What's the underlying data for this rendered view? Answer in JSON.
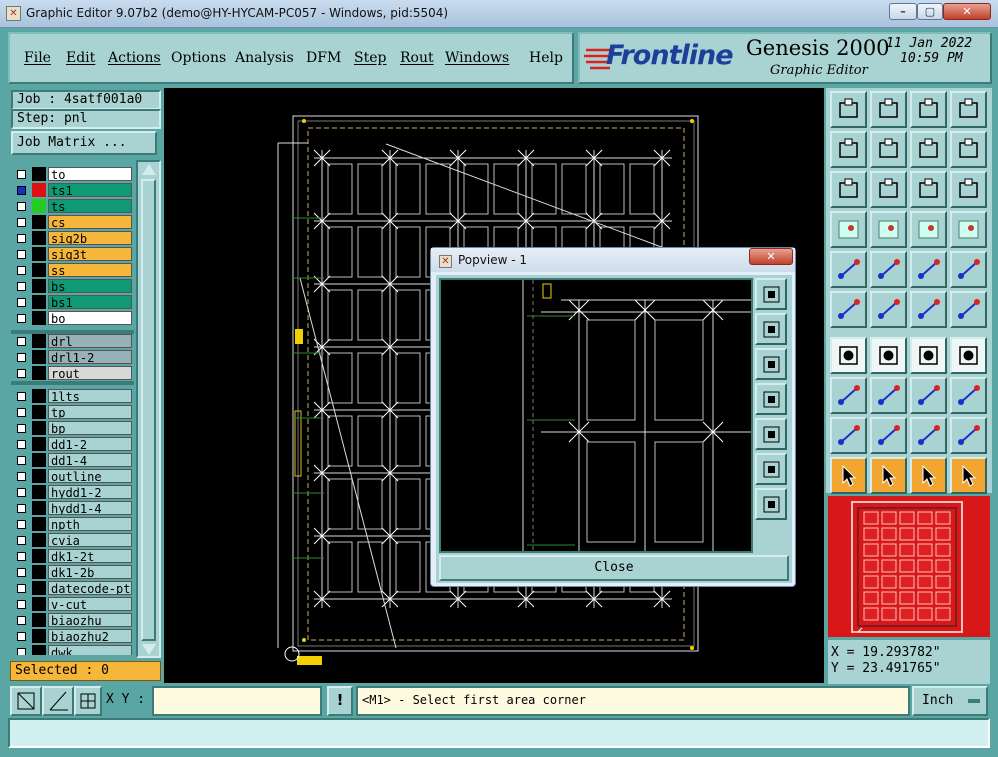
{
  "window": {
    "title": "Graphic Editor 9.07b2 (demo@HY-HYCAM-PC057 - Windows, pid:5504)",
    "min": "–",
    "max": "▢",
    "close": "✕"
  },
  "menu": {
    "file": "File",
    "edit": "Edit",
    "actions": "Actions",
    "options": "Options",
    "analysis": "Analysis",
    "dfm": "DFM",
    "step": "Step",
    "rout": "Rout",
    "windows": "Windows",
    "help": "Help"
  },
  "brand": {
    "logo": "Frontline",
    "product": "Genesis 2000",
    "subtitle": "Graphic Editor",
    "date": "11 Jan 2022",
    "time": "10:59 PM"
  },
  "job": {
    "label": "Job : 4satf001a0",
    "step": "Step: pnl",
    "matrix_button": "Job Matrix ..."
  },
  "layers": [
    {
      "name": "to",
      "color": "#ffffff",
      "sw": "#000000"
    },
    {
      "name": "ts1",
      "color": "#0e9b74",
      "sw": "#e01010",
      "sel": true
    },
    {
      "name": "ts",
      "color": "#0e9b74",
      "sw": "#22cc22"
    },
    {
      "name": "cs",
      "color": "#f5b63a",
      "sw": "#000000"
    },
    {
      "name": "sig2b",
      "color": "#f5b63a",
      "sw": "#000000"
    },
    {
      "name": "sig3t",
      "color": "#f5b63a",
      "sw": "#000000"
    },
    {
      "name": "ss",
      "color": "#f5b63a",
      "sw": "#000000"
    },
    {
      "name": "bs",
      "color": "#0e9b74",
      "sw": "#000000"
    },
    {
      "name": "bs1",
      "color": "#0e9b74",
      "sw": "#000000"
    },
    {
      "name": "bo",
      "color": "#ffffff",
      "sw": "#000000"
    },
    {
      "name": "drl",
      "color": "#98b0b8",
      "sw": "#000000"
    },
    {
      "name": "drl1-2",
      "color": "#98b0b8",
      "sw": "#000000"
    },
    {
      "name": "rout",
      "color": "#d8d8d8",
      "sw": "#000000"
    },
    {
      "name": "1lts",
      "color": "#a9d3d2",
      "sw": "#000000"
    },
    {
      "name": "tp",
      "color": "#a9d3d2",
      "sw": "#000000"
    },
    {
      "name": "bp",
      "color": "#a9d3d2",
      "sw": "#000000"
    },
    {
      "name": "dd1-2",
      "color": "#a9d3d2",
      "sw": "#000000"
    },
    {
      "name": "dd1-4",
      "color": "#a9d3d2",
      "sw": "#000000"
    },
    {
      "name": "outline",
      "color": "#a9d3d2",
      "sw": "#000000"
    },
    {
      "name": "hydd1-2",
      "color": "#a9d3d2",
      "sw": "#000000"
    },
    {
      "name": "hydd1-4",
      "color": "#a9d3d2",
      "sw": "#000000"
    },
    {
      "name": "npth",
      "color": "#a9d3d2",
      "sw": "#000000"
    },
    {
      "name": "cvia",
      "color": "#a9d3d2",
      "sw": "#000000"
    },
    {
      "name": "dk1-2t",
      "color": "#a9d3d2",
      "sw": "#000000"
    },
    {
      "name": "dk1-2b",
      "color": "#a9d3d2",
      "sw": "#000000"
    },
    {
      "name": "datecode-pt",
      "color": "#a9d3d2",
      "sw": "#000000"
    },
    {
      "name": "v-cut",
      "color": "#a9d3d2",
      "sw": "#000000"
    },
    {
      "name": "biaozhu",
      "color": "#a9d3d2",
      "sw": "#000000"
    },
    {
      "name": "biaozhu2",
      "color": "#a9d3d2",
      "sw": "#000000"
    },
    {
      "name": "dwk",
      "color": "#a9d3d2",
      "sw": "#000000"
    }
  ],
  "selected": "Selected : 0",
  "popview": {
    "title": "Popview - 1",
    "close": "Close",
    "x": "✕"
  },
  "coords": {
    "x": "X = 19.293782\"",
    "y": "Y = 23.491765\""
  },
  "status": {
    "xy_label": "X Y :",
    "xy_value": "",
    "message": "<M1> - Select first area corner",
    "units": "Inch"
  },
  "tool_icons": [
    "zoom-in-icon",
    "zoom-out-icon",
    "home-icon",
    "zoom-window-icon",
    "pan-left-icon",
    "pan-right-icon",
    "redraw-icon",
    "snap-icon",
    "fit-icon",
    "center-icon",
    "scale-icon",
    "help-icon",
    "measure-icon",
    "grid-icon",
    "layer-icon",
    "layer-alt-icon",
    "pad-icon",
    "rect-icon",
    "ruler-icon",
    "round-pad-icon",
    "connect-icon",
    "cross-icon",
    "line-pad-icon",
    "net-icon",
    "arc-icon",
    "line-icon",
    "rotate-icon",
    "mirror-icon",
    "move-icon",
    "stretch-icon",
    "dim-icon",
    "copy-icon",
    "poly-a-icon",
    "poly-b-icon",
    "poly-c-icon",
    "poly-d-icon",
    "pointer-icon",
    "select-icon",
    "select-alt-icon",
    "route-icon"
  ]
}
